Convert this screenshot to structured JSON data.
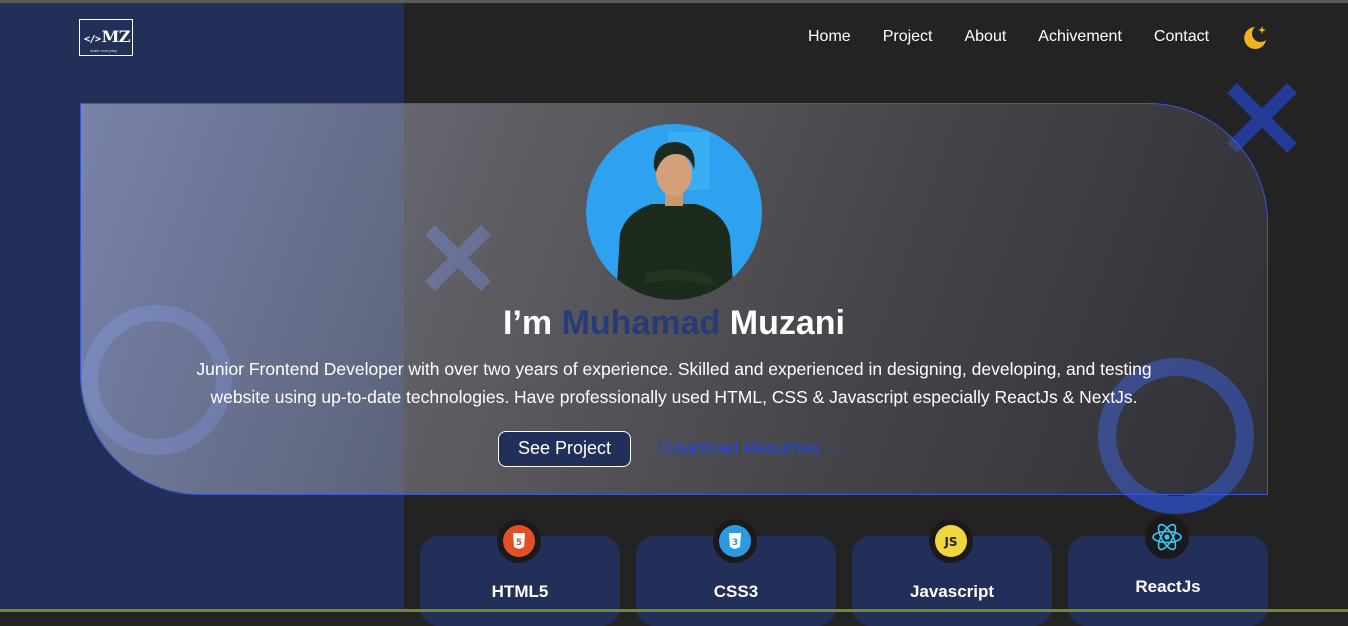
{
  "logo": {
    "mark": "MZ",
    "code_symbol": "</>",
    "tagline": "make everyday"
  },
  "nav": {
    "items": [
      "Home",
      "Project",
      "About",
      "Achivement",
      "Contact"
    ],
    "theme_toggle_icon": "moon-icon"
  },
  "hero": {
    "greeting": "I’m",
    "first_name": "Muhamad",
    "last_name": "Muzani",
    "description": "Junior Frontend Developer with over two years of experience. Skilled and experienced in designing, developing, and testing website using up-to-date technologies. Have professionally used HTML, CSS & Javascript especially ReactJs & NextJs.",
    "primary_button": "See Project",
    "secondary_button": "Download Resumes",
    "secondary_icon": "arrow-right-icon"
  },
  "skills": [
    {
      "name": "HTML5",
      "icon": "html5-icon"
    },
    {
      "name": "CSS3",
      "icon": "css3-icon"
    },
    {
      "name": "Javascript",
      "icon": "javascript-icon",
      "badge_text": "JS"
    },
    {
      "name": "ReactJs",
      "icon": "react-icon"
    }
  ],
  "colors": {
    "background": "#232323",
    "panel_navy": "#222f58",
    "accent_blue": "#2347d6",
    "name_highlight": "#263b78",
    "moon_yellow": "#f0b41c"
  }
}
